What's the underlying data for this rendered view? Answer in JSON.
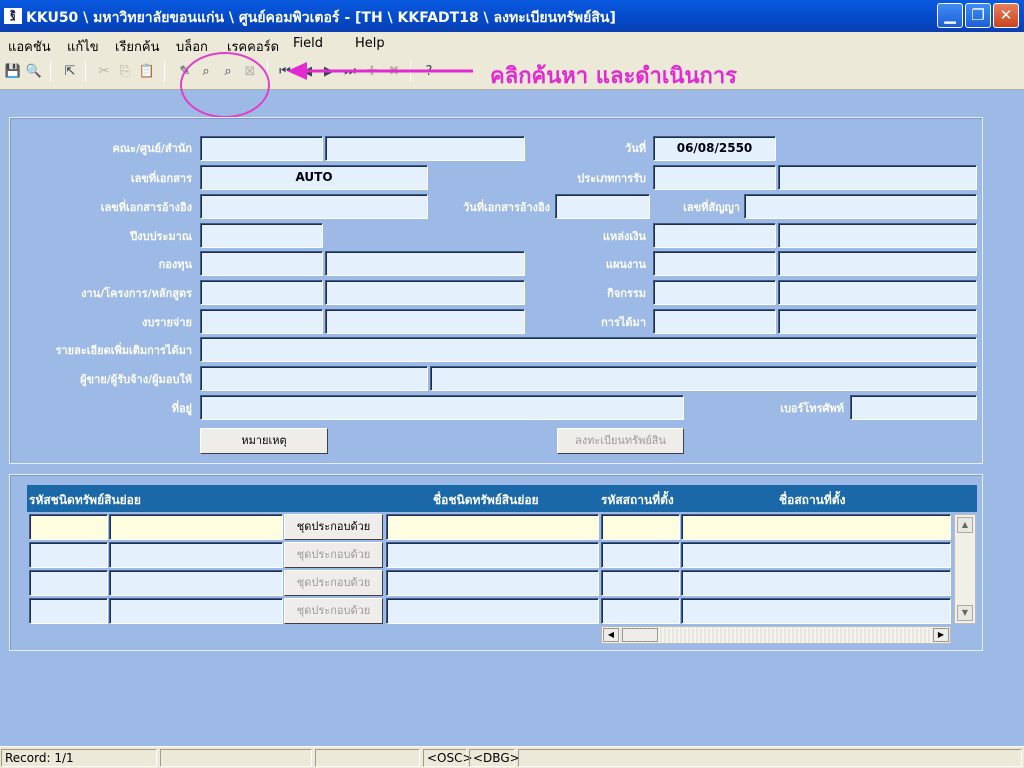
{
  "window": {
    "title": "KKU50 \\ มหาวิทยาลัยขอนแก่น \\ ศูนย์คอมพิวเตอร์ - [TH \\ KKFADT18 \\ ลงทะเบียนทรัพย์สิน]",
    "app_icon_text": "ฐิ"
  },
  "menu": [
    "แอคชัน",
    "แก้ไข",
    "เรียกค้น",
    "บล็อก",
    "เรคคอร์ด",
    "Field",
    "Help"
  ],
  "toolbar": {
    "icons": [
      "save-icon",
      "print-preview-icon",
      "exit-icon",
      "cut-icon",
      "copy-icon",
      "paste-icon",
      "enter-query-icon",
      "execute-query-icon",
      "count-query-icon",
      "cancel-query-icon",
      "first-record-icon",
      "previous-record-icon",
      "next-record-icon",
      "last-record-icon",
      "insert-record-icon",
      "delete-record-icon",
      "help-icon"
    ],
    "annotation_text": "คลิกค้นหา และดำเนินการ",
    "annotation_color": "#e22ad0"
  },
  "header_form": {
    "labels": {
      "faculty": "คณะ/ศูนย์/สำนัก",
      "doc_no": "เลขที่เอกสาร",
      "ref_doc_no": "เลขที่เอกสารอ้างอิง",
      "budget_year": "ปีงบประมาณ",
      "fund": "กองทุน",
      "project": "งาน/โครงการ/หลักสูตร",
      "expense": "งบรายจ่าย",
      "details": "รายละเอียดเพิ่มเติมการได้มา",
      "vendor": "ผู้ขาย/ผู้รับจ้าง/ผู้มอบให้",
      "address": "ที่อยู่",
      "date": "วันที่",
      "receipt_type": "ประเภทการรับ",
      "ref_doc_date": "วันที่เอกสารอ้างอิง",
      "contract_no": "เลขที่สัญญา",
      "fund_source": "แหล่งเงิน",
      "plan": "แผนงาน",
      "activity": "กิจกรรม",
      "acquisition": "การได้มา",
      "phone": "เบอร์โทรศัพท์"
    },
    "values": {
      "date": "06/08/2550",
      "doc_no": "AUTO"
    },
    "buttons": {
      "remark": "หมายเหตุ",
      "register": "ลงทะเบียนทรัพย์สิน"
    }
  },
  "detail_grid": {
    "columns": [
      "รหัสชนิดทรัพย์สินย่อย",
      "ชื่อชนิดทรัพย์สินย่อย",
      "รหัสสถานที่ตั้ง",
      "ชื่อสถานที่ตั้ง"
    ],
    "row_button": "ชุดประกอบด้วย",
    "row_count": 4
  },
  "status": {
    "record": "Record: 1/1",
    "osc": "<OSC>",
    "dbg": "<DBG>"
  }
}
